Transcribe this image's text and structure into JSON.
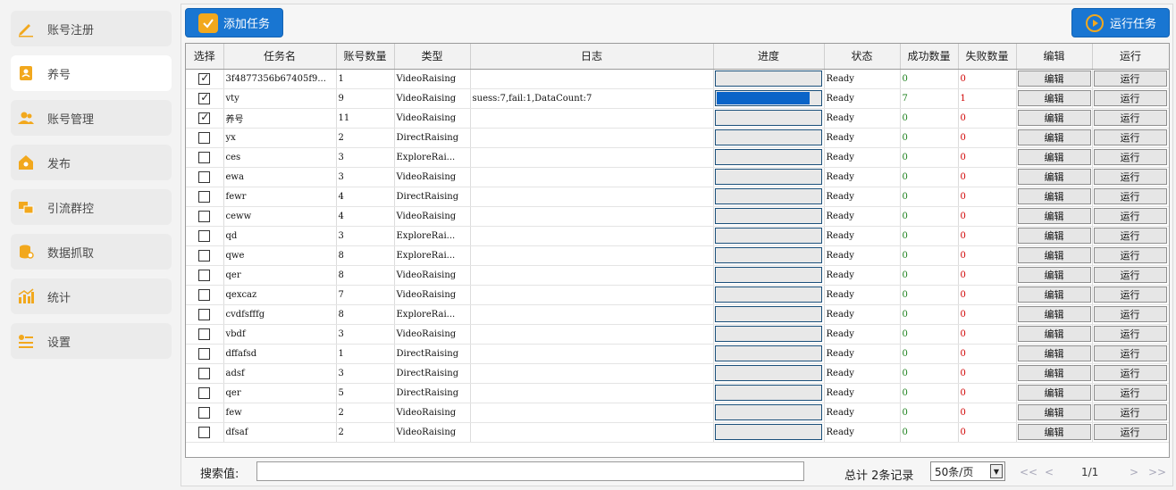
{
  "sidebar": {
    "items": [
      {
        "label": "账号注册",
        "icon": "pencil-icon"
      },
      {
        "label": "养号",
        "icon": "id-card-icon"
      },
      {
        "label": "账号管理",
        "icon": "users-icon"
      },
      {
        "label": "发布",
        "icon": "home-icon"
      },
      {
        "label": "引流群控",
        "icon": "cards-icon"
      },
      {
        "label": "数据抓取",
        "icon": "database-icon"
      },
      {
        "label": "统计",
        "icon": "bar-chart-icon"
      },
      {
        "label": "设置",
        "icon": "settings-list-icon"
      }
    ],
    "active_index": 1
  },
  "toolbar": {
    "add_label": "添加任务",
    "run_label": "运行任务"
  },
  "table": {
    "headers": [
      "选择",
      "任务名",
      "账号数量",
      "类型",
      "日志",
      "进度",
      "状态",
      "成功数量",
      "失败数量",
      "编辑",
      "运行"
    ],
    "edit_label": "编辑",
    "run_label": "运行",
    "rows": [
      {
        "checked": true,
        "name": "3f4877356b67405f9...",
        "count": "1",
        "type": "VideoRaising",
        "log": "",
        "progress": 0,
        "status": "Ready",
        "success": "0",
        "fail": "0"
      },
      {
        "checked": true,
        "name": "vty",
        "count": "9",
        "type": "VideoRaising",
        "log": "suess:7,fail:1,DataCount:7",
        "progress": 0.88,
        "status": "Ready",
        "success": "7",
        "fail": "1"
      },
      {
        "checked": true,
        "name": "养号",
        "count": "11",
        "type": "VideoRaising",
        "log": "",
        "progress": 0,
        "status": "Ready",
        "success": "0",
        "fail": "0"
      },
      {
        "checked": false,
        "name": "yx",
        "count": "2",
        "type": "DirectRaising",
        "log": "",
        "progress": 0,
        "status": "Ready",
        "success": "0",
        "fail": "0"
      },
      {
        "checked": false,
        "name": "ces",
        "count": "3",
        "type": "ExploreRai...",
        "log": "",
        "progress": 0,
        "status": "Ready",
        "success": "0",
        "fail": "0"
      },
      {
        "checked": false,
        "name": "ewa",
        "count": "3",
        "type": "VideoRaising",
        "log": "",
        "progress": 0,
        "status": "Ready",
        "success": "0",
        "fail": "0"
      },
      {
        "checked": false,
        "name": "fewr",
        "count": "4",
        "type": "DirectRaising",
        "log": "",
        "progress": 0,
        "status": "Ready",
        "success": "0",
        "fail": "0"
      },
      {
        "checked": false,
        "name": "ceww",
        "count": "4",
        "type": "VideoRaising",
        "log": "",
        "progress": 0,
        "status": "Ready",
        "success": "0",
        "fail": "0"
      },
      {
        "checked": false,
        "name": "qd",
        "count": "3",
        "type": "ExploreRai...",
        "log": "",
        "progress": 0,
        "status": "Ready",
        "success": "0",
        "fail": "0"
      },
      {
        "checked": false,
        "name": "qwe",
        "count": "8",
        "type": "ExploreRai...",
        "log": "",
        "progress": 0,
        "status": "Ready",
        "success": "0",
        "fail": "0"
      },
      {
        "checked": false,
        "name": "qer",
        "count": "8",
        "type": "VideoRaising",
        "log": "",
        "progress": 0,
        "status": "Ready",
        "success": "0",
        "fail": "0"
      },
      {
        "checked": false,
        "name": "qexcaz",
        "count": "7",
        "type": "VideoRaising",
        "log": "",
        "progress": 0,
        "status": "Ready",
        "success": "0",
        "fail": "0"
      },
      {
        "checked": false,
        "name": "cvdfsfffg",
        "count": "8",
        "type": "ExploreRai...",
        "log": "",
        "progress": 0,
        "status": "Ready",
        "success": "0",
        "fail": "0"
      },
      {
        "checked": false,
        "name": "vbdf",
        "count": "3",
        "type": "VideoRaising",
        "log": "",
        "progress": 0,
        "status": "Ready",
        "success": "0",
        "fail": "0"
      },
      {
        "checked": false,
        "name": "dffafsd",
        "count": "1",
        "type": "DirectRaising",
        "log": "",
        "progress": 0,
        "status": "Ready",
        "success": "0",
        "fail": "0"
      },
      {
        "checked": false,
        "name": "adsf",
        "count": "3",
        "type": "DirectRaising",
        "log": "",
        "progress": 0,
        "status": "Ready",
        "success": "0",
        "fail": "0"
      },
      {
        "checked": false,
        "name": "qer",
        "count": "5",
        "type": "DirectRaising",
        "log": "",
        "progress": 0,
        "status": "Ready",
        "success": "0",
        "fail": "0"
      },
      {
        "checked": false,
        "name": "few",
        "count": "2",
        "type": "VideoRaising",
        "log": "",
        "progress": 0,
        "status": "Ready",
        "success": "0",
        "fail": "0"
      },
      {
        "checked": false,
        "name": "dfsaf",
        "count": "2",
        "type": "VideoRaising",
        "log": "",
        "progress": 0,
        "status": "Ready",
        "success": "0",
        "fail": "0"
      }
    ]
  },
  "footer": {
    "search_label": "搜索值:",
    "search_value": "",
    "total": "总计 2条记录",
    "page_size": "50条/页",
    "first": "<<",
    "prev": "<",
    "page_info": "1/1",
    "next": ">",
    "last": ">>"
  },
  "colors": {
    "accent": "#1976d2",
    "icon_orange": "#f2a81d",
    "success": "#1a7f1a",
    "fail": "#d00000"
  }
}
